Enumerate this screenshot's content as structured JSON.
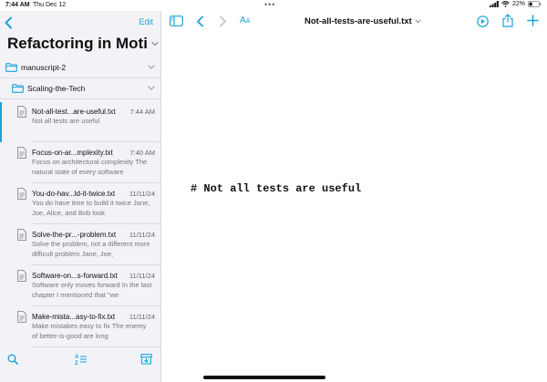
{
  "status_bar": {
    "time": "7:44 AM",
    "date": "Thu Dec 12",
    "battery": "22%"
  },
  "sidebar": {
    "edit_label": "Edit",
    "title": "Refactoring in Moti",
    "folders": [
      {
        "label": "manuscript-2"
      },
      {
        "label": "Scaling-the-Tech"
      }
    ],
    "files": [
      {
        "name": "Not-all-test...are-useful.txt",
        "date": "7:44 AM",
        "preview": "Not all tests are useful",
        "selected": true
      },
      {
        "name": "Focus-on-ar...mplexity.txt",
        "date": "7:40 AM",
        "preview": "Focus on architectural complexity The natural state of every software"
      },
      {
        "name": "You-do-hav...ld-it-twice.txt",
        "date": "11/11/24",
        "preview": "You do have time to build it twice Jane, Joe, Alice, and Bob look"
      },
      {
        "name": "Solve-the-pr...-problem.txt",
        "date": "11/11/24",
        "preview": "Solve the problem, not a different more difficult problem Jane, Joe,"
      },
      {
        "name": "Software-on...s-forward.txt",
        "date": "11/11/24",
        "preview": "Software only moves forward In the last chapter I mentioned that \"we"
      },
      {
        "name": "Make-mista...asy-to-fix.txt",
        "date": "11/11/24",
        "preview": "Make mistakes easy to fix The enemy of better-is-good are long"
      }
    ]
  },
  "main": {
    "font_button": {
      "big": "A",
      "small": "A"
    },
    "filename": "Not-all-tests-are-useful.txt",
    "content": "# Not all tests are useful"
  },
  "colors": {
    "accent": "#1aa3d9",
    "sidebar_bg": "#f2f2f7"
  }
}
